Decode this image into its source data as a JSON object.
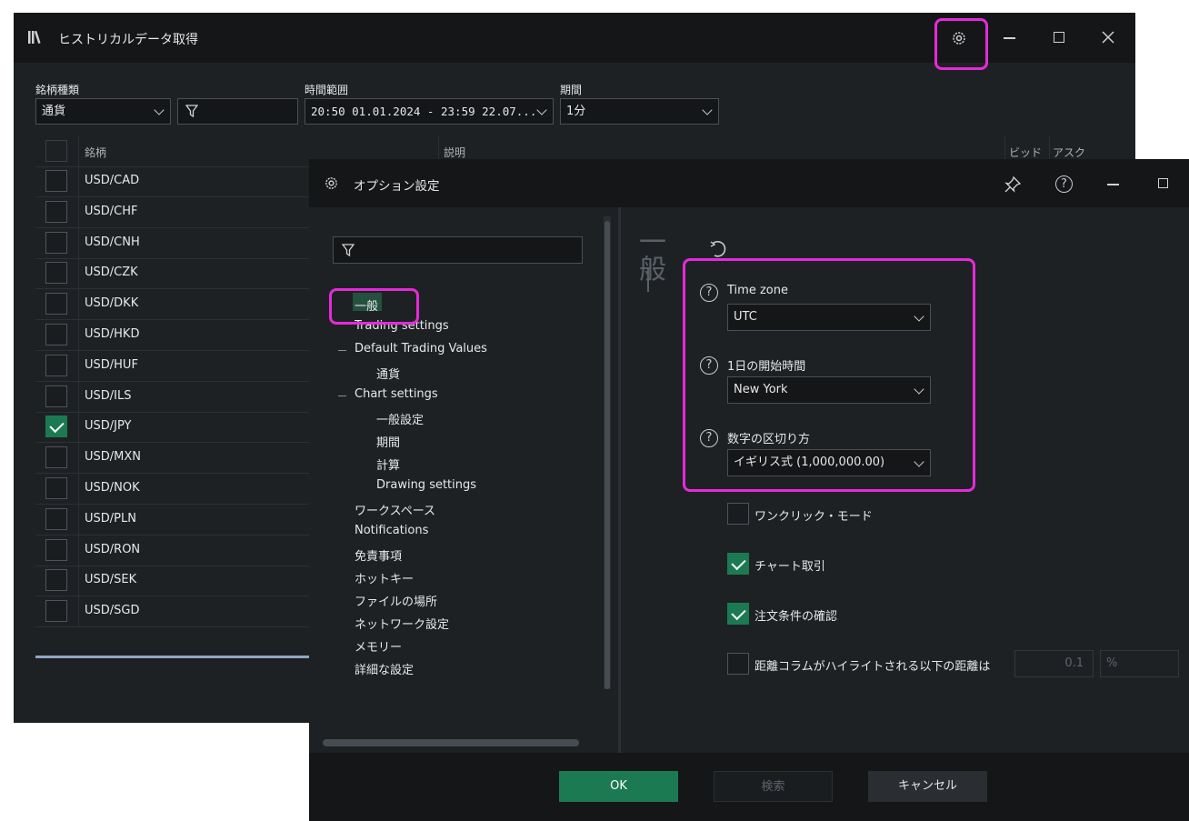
{
  "history_window": {
    "title": "ヒストリカルデータ取得",
    "labels": {
      "symbol_type": "銘柄種類",
      "time_range": "時間範囲",
      "period": "期間"
    },
    "symbol_type_value": "通貨",
    "time_range_value": "20:50 01.01.2024 - 23:59 22.07...",
    "period_value": "1分",
    "columns": {
      "symbol": "銘柄",
      "description": "説明",
      "bid": "ビッド",
      "ask": "アスク"
    },
    "rows": [
      {
        "symbol": "USD/CAD",
        "checked": false
      },
      {
        "symbol": "USD/CHF",
        "checked": false
      },
      {
        "symbol": "USD/CNH",
        "checked": false
      },
      {
        "symbol": "USD/CZK",
        "checked": false
      },
      {
        "symbol": "USD/DKK",
        "checked": false
      },
      {
        "symbol": "USD/HKD",
        "checked": false
      },
      {
        "symbol": "USD/HUF",
        "checked": false
      },
      {
        "symbol": "USD/ILS",
        "checked": false
      },
      {
        "symbol": "USD/JPY",
        "checked": true
      },
      {
        "symbol": "USD/MXN",
        "checked": false
      },
      {
        "symbol": "USD/NOK",
        "checked": false
      },
      {
        "symbol": "USD/PLN",
        "checked": false
      },
      {
        "symbol": "USD/RON",
        "checked": false
      },
      {
        "symbol": "USD/SEK",
        "checked": false
      },
      {
        "symbol": "USD/SGD",
        "checked": false
      }
    ],
    "icons": {
      "app": "library-icon",
      "settings": "gear-icon",
      "minimize": "minimize-icon",
      "maximize": "maximize-icon",
      "close": "close-icon",
      "filter": "filter-icon"
    }
  },
  "options_dialog": {
    "title": "オプション設定",
    "section_heading": "一般",
    "tree": [
      {
        "label": "一般",
        "level": 0,
        "selected": true
      },
      {
        "label": "Trading settings",
        "level": 0
      },
      {
        "label": "Default Trading Values",
        "level": 0,
        "expanded": true
      },
      {
        "label": "通貨",
        "level": 1
      },
      {
        "label": "Chart settings",
        "level": 0,
        "expanded": true
      },
      {
        "label": "一般設定",
        "level": 1
      },
      {
        "label": "期間",
        "level": 1
      },
      {
        "label": "計算",
        "level": 1
      },
      {
        "label": "Drawing settings",
        "level": 1
      },
      {
        "label": "ワークスペース",
        "level": 0
      },
      {
        "label": "Notifications",
        "level": 0
      },
      {
        "label": "免責事項",
        "level": 0
      },
      {
        "label": "ホットキー",
        "level": 0
      },
      {
        "label": "ファイルの場所",
        "level": 0
      },
      {
        "label": "ネットワーク設定",
        "level": 0
      },
      {
        "label": "メモリー",
        "level": 0
      },
      {
        "label": "詳細な設定",
        "level": 0
      }
    ],
    "settings": {
      "time_zone_label": "Time zone",
      "time_zone_value": "UTC",
      "day_start_label": "1日の開始時間",
      "day_start_value": "New York",
      "number_format_label": "数字の区切り方",
      "number_format_value": "イギリス式 (1,000,000.00)",
      "one_click_label": "ワンクリック・モード",
      "one_click_checked": false,
      "chart_trading_label": "チャート取引",
      "chart_trading_checked": true,
      "order_confirm_label": "注文条件の確認",
      "order_confirm_checked": true,
      "distance_label": "距離コラムがハイライトされる以下の距離は",
      "distance_checked": false,
      "distance_value": "0.1",
      "distance_unit": "%"
    },
    "buttons": {
      "ok": "OK",
      "search": "検索",
      "cancel": "キャンセル"
    },
    "help_glyph": "?",
    "colors": {
      "accent_green": "#1c7a52",
      "highlight_pink": "#e52ad9",
      "background": "#1e2124",
      "titlebar": "#141618"
    }
  }
}
